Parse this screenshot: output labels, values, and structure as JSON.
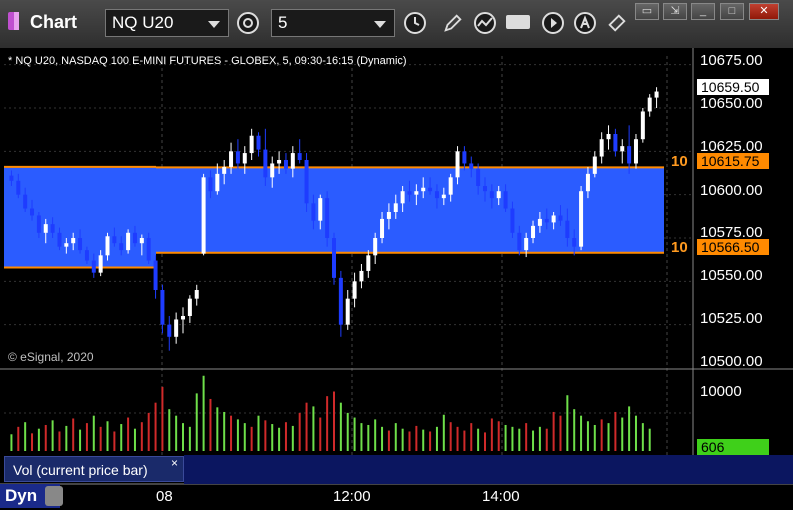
{
  "window": {
    "title": "Chart",
    "symbol": "NQ U20",
    "interval": "5"
  },
  "header": {
    "instrument": "* NQ U20, NASDAQ 100 E-MINI FUTURES - GLOBEX, 5, 09:30-16:15 (Dynamic)"
  },
  "price_axis": {
    "labels": [
      "10675.00",
      "10650.00",
      "10625.00",
      "10600.00",
      "10575.00",
      "10550.00",
      "10525.00",
      "10500.00"
    ],
    "last_price": "10659.50",
    "upper_level": "10615.75",
    "lower_level": "10566.50",
    "upper_level_count": "10",
    "lower_level_count": "10"
  },
  "volume_axis": {
    "label": "10000",
    "current": "606"
  },
  "footer": {
    "copyright": "© eSignal, 2020",
    "volume_study": "Vol (current price bar)",
    "close_glyph": "×",
    "mode": "Dyn",
    "time_labels": [
      "08",
      "12:00",
      "14:00"
    ]
  },
  "colors": {
    "up": "#ffffff",
    "down": "#1e3cff",
    "zone": "#2b5cff",
    "level": "#ff8a00",
    "vol_up": "#6fe04a",
    "vol_down": "#d02a2a",
    "current_vol": "#3fd01a"
  },
  "chart_data": {
    "type": "candlestick",
    "ylim": [
      10500,
      10680
    ],
    "zones": [
      {
        "top": 10616,
        "bottom": 10558
      },
      {
        "top": 10615.75,
        "bottom": 10566.5
      }
    ],
    "candles": [
      [
        10611,
        10614,
        10605,
        10608
      ],
      [
        10608,
        10612,
        10598,
        10600
      ],
      [
        10600,
        10604,
        10590,
        10592
      ],
      [
        10592,
        10597,
        10585,
        10588
      ],
      [
        10588,
        10590,
        10575,
        10578
      ],
      [
        10578,
        10586,
        10572,
        10583
      ],
      [
        10583,
        10587,
        10575,
        10578
      ],
      [
        10578,
        10581,
        10568,
        10570
      ],
      [
        10570,
        10575,
        10566,
        10572
      ],
      [
        10572,
        10578,
        10568,
        10575
      ],
      [
        10575,
        10580,
        10566,
        10568
      ],
      [
        10568,
        10570,
        10560,
        10562
      ],
      [
        10562,
        10566,
        10552,
        10555
      ],
      [
        10555,
        10568,
        10553,
        10565
      ],
      [
        10565,
        10578,
        10562,
        10576
      ],
      [
        10576,
        10581,
        10570,
        10572
      ],
      [
        10572,
        10576,
        10565,
        10568
      ],
      [
        10568,
        10580,
        10566,
        10578
      ],
      [
        10578,
        10582,
        10570,
        10572
      ],
      [
        10572,
        10577,
        10565,
        10575
      ],
      [
        10575,
        10578,
        10560,
        10562
      ],
      [
        10562,
        10565,
        10540,
        10545
      ],
      [
        10545,
        10548,
        10520,
        10525
      ],
      [
        10525,
        10530,
        10510,
        10518
      ],
      [
        10518,
        10532,
        10514,
        10528
      ],
      [
        10528,
        10535,
        10520,
        10530
      ],
      [
        10530,
        10542,
        10526,
        10540
      ],
      [
        10540,
        10548,
        10536,
        10545
      ],
      [
        10566,
        10612,
        10565,
        10610
      ],
      [
        10610,
        10614,
        10598,
        10602
      ],
      [
        10602,
        10618,
        10600,
        10612
      ],
      [
        10612,
        10620,
        10606,
        10616
      ],
      [
        10616,
        10630,
        10612,
        10625
      ],
      [
        10625,
        10632,
        10615,
        10618
      ],
      [
        10618,
        10628,
        10612,
        10624
      ],
      [
        10624,
        10638,
        10620,
        10634
      ],
      [
        10634,
        10636,
        10622,
        10626
      ],
      [
        10626,
        10638,
        10605,
        10610
      ],
      [
        10610,
        10622,
        10604,
        10618
      ],
      [
        10618,
        10625,
        10612,
        10620
      ],
      [
        10620,
        10624,
        10612,
        10615
      ],
      [
        10615,
        10628,
        10610,
        10624
      ],
      [
        10624,
        10632,
        10618,
        10620
      ],
      [
        10620,
        10624,
        10590,
        10595
      ],
      [
        10595,
        10600,
        10580,
        10585
      ],
      [
        10585,
        10600,
        10580,
        10598
      ],
      [
        10598,
        10602,
        10570,
        10575
      ],
      [
        10575,
        10578,
        10548,
        10552
      ],
      [
        10552,
        10556,
        10518,
        10525
      ],
      [
        10525,
        10545,
        10522,
        10540
      ],
      [
        10540,
        10555,
        10535,
        10550
      ],
      [
        10550,
        10560,
        10546,
        10556
      ],
      [
        10556,
        10568,
        10552,
        10565
      ],
      [
        10565,
        10578,
        10560,
        10575
      ],
      [
        10575,
        10590,
        10572,
        10586
      ],
      [
        10586,
        10595,
        10580,
        10590
      ],
      [
        10590,
        10600,
        10586,
        10595
      ],
      [
        10595,
        10605,
        10590,
        10602
      ],
      [
        10602,
        10608,
        10596,
        10600
      ],
      [
        10600,
        10606,
        10594,
        10602
      ],
      [
        10602,
        10610,
        10598,
        10604
      ],
      [
        10604,
        10610,
        10600,
        10602
      ],
      [
        10602,
        10606,
        10592,
        10598
      ],
      [
        10598,
        10604,
        10594,
        10600
      ],
      [
        10600,
        10612,
        10596,
        10610
      ],
      [
        10610,
        10628,
        10606,
        10625
      ],
      [
        10625,
        10628,
        10614,
        10618
      ],
      [
        10618,
        10622,
        10610,
        10615
      ],
      [
        10615,
        10618,
        10600,
        10605
      ],
      [
        10605,
        10610,
        10596,
        10602
      ],
      [
        10602,
        10606,
        10592,
        10598
      ],
      [
        10598,
        10605,
        10594,
        10602
      ],
      [
        10602,
        10606,
        10590,
        10592
      ],
      [
        10592,
        10596,
        10575,
        10578
      ],
      [
        10578,
        10582,
        10565,
        10568
      ],
      [
        10568,
        10578,
        10564,
        10575
      ],
      [
        10575,
        10585,
        10572,
        10582
      ],
      [
        10582,
        10590,
        10578,
        10586
      ],
      [
        10586,
        10592,
        10580,
        10584
      ],
      [
        10584,
        10590,
        10580,
        10588
      ],
      [
        10588,
        10594,
        10582,
        10585
      ],
      [
        10585,
        10592,
        10570,
        10575
      ],
      [
        10575,
        10580,
        10565,
        10570
      ],
      [
        10570,
        10605,
        10568,
        10602
      ],
      [
        10602,
        10616,
        10598,
        10612
      ],
      [
        10612,
        10625,
        10610,
        10622
      ],
      [
        10622,
        10636,
        10618,
        10632
      ],
      [
        10632,
        10640,
        10626,
        10635
      ],
      [
        10635,
        10638,
        10622,
        10625
      ],
      [
        10625,
        10632,
        10618,
        10628
      ],
      [
        10628,
        10640,
        10612,
        10618
      ],
      [
        10618,
        10635,
        10615,
        10632
      ],
      [
        10632,
        10650,
        10630,
        10648
      ],
      [
        10648,
        10658,
        10645,
        10656
      ],
      [
        10656,
        10662,
        10650,
        10659.5
      ]
    ],
    "volume": [
      [
        180,
        1
      ],
      [
        260,
        0
      ],
      [
        310,
        1
      ],
      [
        190,
        0
      ],
      [
        240,
        1
      ],
      [
        280,
        0
      ],
      [
        330,
        1
      ],
      [
        210,
        0
      ],
      [
        270,
        1
      ],
      [
        350,
        0
      ],
      [
        230,
        1
      ],
      [
        300,
        0
      ],
      [
        380,
        1
      ],
      [
        260,
        0
      ],
      [
        320,
        1
      ],
      [
        210,
        0
      ],
      [
        290,
        1
      ],
      [
        360,
        0
      ],
      [
        240,
        1
      ],
      [
        310,
        0
      ],
      [
        410,
        0
      ],
      [
        520,
        0
      ],
      [
        690,
        0
      ],
      [
        450,
        1
      ],
      [
        380,
        1
      ],
      [
        300,
        1
      ],
      [
        260,
        1
      ],
      [
        620,
        1
      ],
      [
        810,
        1
      ],
      [
        560,
        0
      ],
      [
        470,
        1
      ],
      [
        420,
        1
      ],
      [
        380,
        0
      ],
      [
        340,
        1
      ],
      [
        300,
        1
      ],
      [
        260,
        0
      ],
      [
        380,
        1
      ],
      [
        330,
        0
      ],
      [
        290,
        1
      ],
      [
        250,
        1
      ],
      [
        310,
        0
      ],
      [
        270,
        1
      ],
      [
        410,
        0
      ],
      [
        520,
        0
      ],
      [
        480,
        1
      ],
      [
        360,
        0
      ],
      [
        590,
        0
      ],
      [
        640,
        0
      ],
      [
        520,
        1
      ],
      [
        410,
        1
      ],
      [
        360,
        1
      ],
      [
        300,
        1
      ],
      [
        280,
        1
      ],
      [
        340,
        1
      ],
      [
        260,
        1
      ],
      [
        220,
        0
      ],
      [
        300,
        1
      ],
      [
        240,
        1
      ],
      [
        210,
        0
      ],
      [
        270,
        0
      ],
      [
        230,
        1
      ],
      [
        210,
        0
      ],
      [
        260,
        1
      ],
      [
        390,
        1
      ],
      [
        310,
        0
      ],
      [
        260,
        0
      ],
      [
        220,
        0
      ],
      [
        300,
        0
      ],
      [
        240,
        1
      ],
      [
        200,
        0
      ],
      [
        350,
        0
      ],
      [
        320,
        0
      ],
      [
        280,
        1
      ],
      [
        260,
        1
      ],
      [
        240,
        1
      ],
      [
        300,
        0
      ],
      [
        220,
        1
      ],
      [
        260,
        1
      ],
      [
        240,
        0
      ],
      [
        420,
        0
      ],
      [
        380,
        0
      ],
      [
        600,
        1
      ],
      [
        450,
        1
      ],
      [
        380,
        1
      ],
      [
        320,
        1
      ],
      [
        280,
        1
      ],
      [
        340,
        0
      ],
      [
        300,
        1
      ],
      [
        420,
        0
      ],
      [
        360,
        1
      ],
      [
        480,
        1
      ],
      [
        380,
        1
      ],
      [
        300,
        1
      ],
      [
        240,
        1
      ]
    ]
  }
}
